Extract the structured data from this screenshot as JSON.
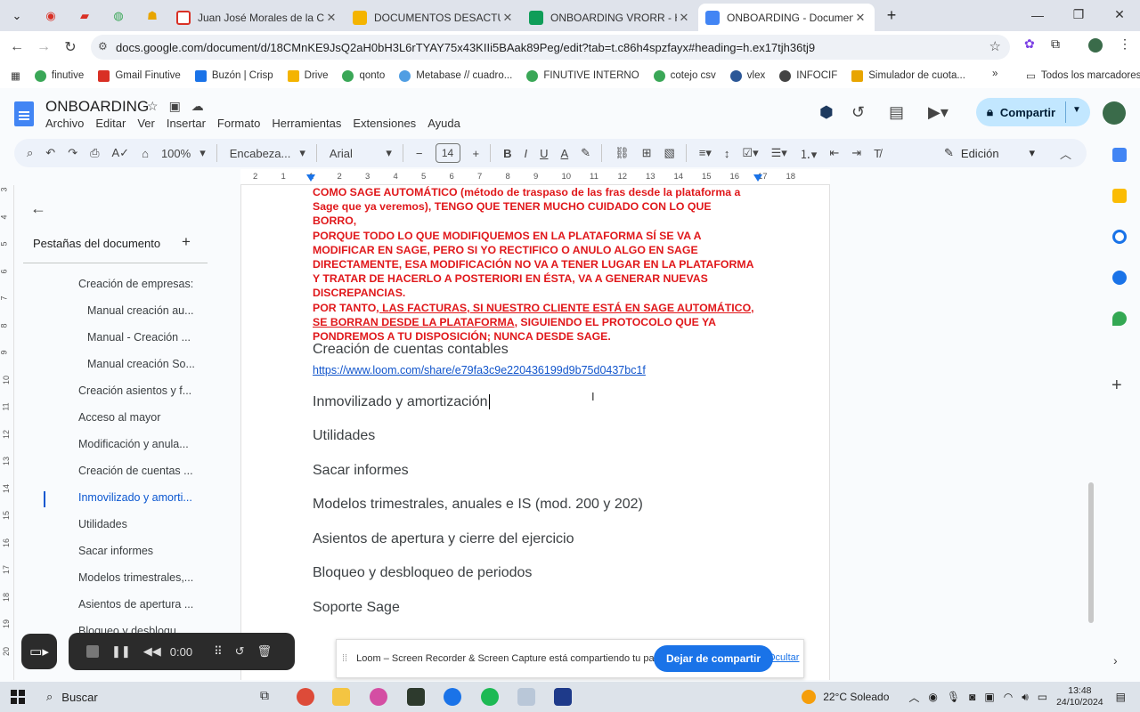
{
  "browser": {
    "tabs": [
      {
        "title": "Juan José Morales de la Cueva",
        "color": "#d93025"
      },
      {
        "title": "DOCUMENTOS DESACTUALIZA",
        "color": "#f4b400"
      },
      {
        "title": "ONBOARDING VRORR - Hojas c",
        "color": "#0f9d58"
      },
      {
        "title": "ONBOARDING - Document",
        "color": "#4285f4"
      }
    ],
    "url": "docs.google.com/document/d/18CMnKE9JsQ2aH0bH3L6rTYAY75x43KIIi5BAak89Peg/edit?tab=t.c86h4spzfayx#heading=h.ex17tjh36tj9",
    "bookmarks": [
      "finutive",
      "Gmail Finutive",
      "Buzón | Crisp",
      "Drive",
      "qonto",
      "Metabase // cuadro...",
      "FINUTIVE INTERNO",
      "cotejo csv",
      "vlex",
      "INFOCIF",
      "Simulador de cuota..."
    ],
    "all_bookmarks": "Todos los marcadores"
  },
  "doc": {
    "title": "ONBOARDING",
    "menu": [
      "Archivo",
      "Editar",
      "Ver",
      "Insertar",
      "Formato",
      "Herramientas",
      "Extensiones",
      "Ayuda"
    ],
    "share_label": "Compartir",
    "toolbar": {
      "zoom": "100%",
      "style": "Encabeza...",
      "font": "Arial",
      "font_size": "14",
      "mode": "Edición"
    },
    "ruler": [
      "2",
      "1",
      "1",
      "2",
      "3",
      "4",
      "5",
      "6",
      "7",
      "8",
      "9",
      "10",
      "11",
      "12",
      "13",
      "14",
      "15",
      "16",
      "17",
      "18"
    ],
    "vruler": [
      "3",
      "4",
      "5",
      "6",
      "7",
      "8",
      "9",
      "10",
      "11",
      "12",
      "13",
      "14",
      "15",
      "16",
      "17",
      "18",
      "19",
      "20"
    ]
  },
  "outline": {
    "header": "Pestañas del documento",
    "items": [
      {
        "label": "Creación de empresas:",
        "indent": 1
      },
      {
        "label": "Manual creación au...",
        "indent": 2
      },
      {
        "label": "Manual - Creación ...",
        "indent": 2
      },
      {
        "label": "Manual creación So...",
        "indent": 2
      },
      {
        "label": "Creación asientos y f...",
        "indent": 1
      },
      {
        "label": "Acceso al mayor",
        "indent": 1
      },
      {
        "label": "Modificación y anula...",
        "indent": 1
      },
      {
        "label": "Creación de cuentas ...",
        "indent": 1
      },
      {
        "label": "Inmovilizado y amorti...",
        "indent": 1,
        "active": true
      },
      {
        "label": "Utilidades",
        "indent": 1
      },
      {
        "label": "Sacar informes",
        "indent": 1
      },
      {
        "label": "Modelos trimestrales,...",
        "indent": 1
      },
      {
        "label": "Asientos de apertura ...",
        "indent": 1
      },
      {
        "label": "Bloqueo y desbloqu...",
        "indent": 1
      }
    ]
  },
  "content": {
    "red_lines": [
      "COMO SAGE AUTOMÁTICO (método de traspaso de las fras desde la plataforma a",
      "Sage que ya veremos), TENGO QUE TENER MUCHO CUIDADO CON LO QUE BORRO,",
      "PORQUE TODO LO QUE MODIFIQUEMOS EN LA PLATAFORMA SÍ SE VA A",
      "MODIFICAR EN SAGE, PERO SI YO RECTIFICO O ANULO ALGO EN SAGE",
      "DIRECTAMENTE, ESA MODIFICACIÓN NO VA A TENER LUGAR EN LA PLATAFORMA",
      "Y TRATAR DE HACERLO A POSTERIORI EN ÉSTA, VA A GENERAR NUEVAS",
      "DISCREPANCIAS.",
      "POR TANTO",
      ", LAS FACTURAS, SI NUESTRO CLIENTE ESTÁ EN SAGE AUTOMÁTICO,",
      "SE BORRAN DESDE LA PLATAFORMA",
      ", SIGUIENDO EL PROTOCOLO QUE YA",
      "PONDREMOS A TU DISPOSICIÓN; NUNCA DESDE SAGE."
    ],
    "heading_cuentas": "Creación de cuentas contables",
    "link": "https://www.loom.com/share/e79fa3c9e220436199d9b75d0437bc1f",
    "headings": [
      "Inmovilizado y amortización",
      "Utilidades",
      "Sacar informes",
      "Modelos trimestrales, anuales e IS (mod. 200 y 202)",
      "Asientos de apertura y cierre del ejercicio",
      "Bloqueo y desbloqueo de periodos",
      "Soporte Sage"
    ]
  },
  "loom": {
    "timer": "0:00",
    "banner_text": "Loom – Screen Recorder & Screen Capture está compartiendo tu pantalla.",
    "stop_label": "Dejar de compartir",
    "hide_label": "Ocultar"
  },
  "taskbar": {
    "search": "Buscar",
    "weather": "22°C  Soleado",
    "time": "13:48",
    "date": "24/10/2024"
  }
}
